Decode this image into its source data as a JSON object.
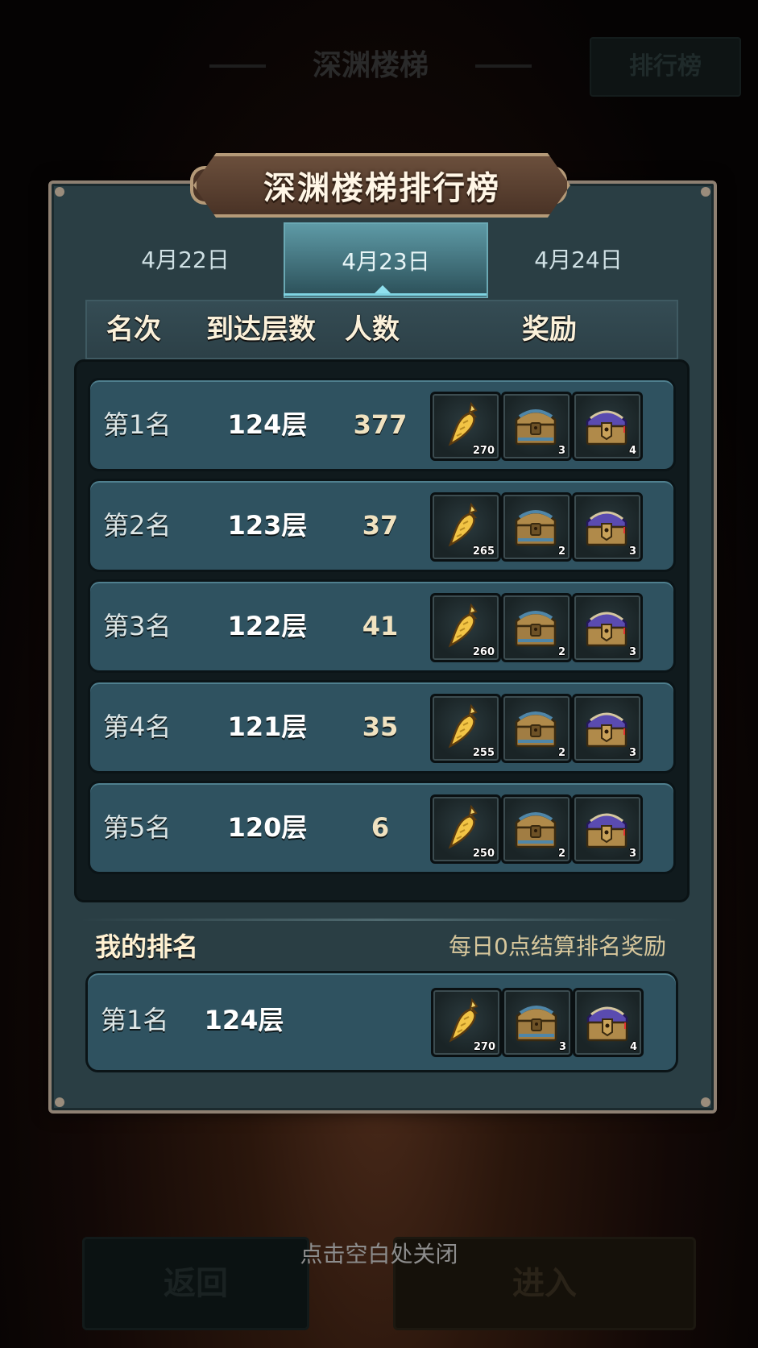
{
  "background": {
    "header_title": "深渊楼梯",
    "rank_button": "排行榜",
    "back_button": "返回",
    "enter_button": "进入"
  },
  "modal": {
    "title": "深渊楼梯排行榜",
    "tabs": [
      {
        "label": "4月22日",
        "active": false
      },
      {
        "label": "4月23日",
        "active": true
      },
      {
        "label": "4月24日",
        "active": false
      }
    ],
    "columns": {
      "rank": "名次",
      "floor": "到达层数",
      "players": "人数",
      "reward": "奖励"
    },
    "rows": [
      {
        "rank": "第1名",
        "floor": "124层",
        "players": "377",
        "rewards": [
          {
            "item": "golden-carrot-icon",
            "qty": "270"
          },
          {
            "item": "gold-chest-icon",
            "qty": "3"
          },
          {
            "item": "purple-chest-icon",
            "qty": "4"
          }
        ]
      },
      {
        "rank": "第2名",
        "floor": "123层",
        "players": "37",
        "rewards": [
          {
            "item": "golden-carrot-icon",
            "qty": "265"
          },
          {
            "item": "gold-chest-icon",
            "qty": "2"
          },
          {
            "item": "purple-chest-icon",
            "qty": "3"
          }
        ]
      },
      {
        "rank": "第3名",
        "floor": "122层",
        "players": "41",
        "rewards": [
          {
            "item": "golden-carrot-icon",
            "qty": "260"
          },
          {
            "item": "gold-chest-icon",
            "qty": "2"
          },
          {
            "item": "purple-chest-icon",
            "qty": "3"
          }
        ]
      },
      {
        "rank": "第4名",
        "floor": "121层",
        "players": "35",
        "rewards": [
          {
            "item": "golden-carrot-icon",
            "qty": "255"
          },
          {
            "item": "gold-chest-icon",
            "qty": "2"
          },
          {
            "item": "purple-chest-icon",
            "qty": "3"
          }
        ]
      },
      {
        "rank": "第5名",
        "floor": "120层",
        "players": "6",
        "rewards": [
          {
            "item": "golden-carrot-icon",
            "qty": "250"
          },
          {
            "item": "gold-chest-icon",
            "qty": "2"
          },
          {
            "item": "purple-chest-icon",
            "qty": "3"
          }
        ]
      }
    ],
    "my_rank": {
      "label": "我的排名",
      "note": "每日0点结算排名奖励",
      "rank": "第1名",
      "floor": "124层",
      "rewards": [
        {
          "item": "golden-carrot-icon",
          "qty": "270"
        },
        {
          "item": "gold-chest-icon",
          "qty": "3"
        },
        {
          "item": "purple-chest-icon",
          "qty": "4"
        }
      ]
    }
  },
  "close_hint": "点击空白处关闭",
  "colors": {
    "panel": "#2a3e44",
    "row": "#2f5260",
    "active_tab": "#5e9aa6",
    "title_plate": "#6b4f3c"
  }
}
